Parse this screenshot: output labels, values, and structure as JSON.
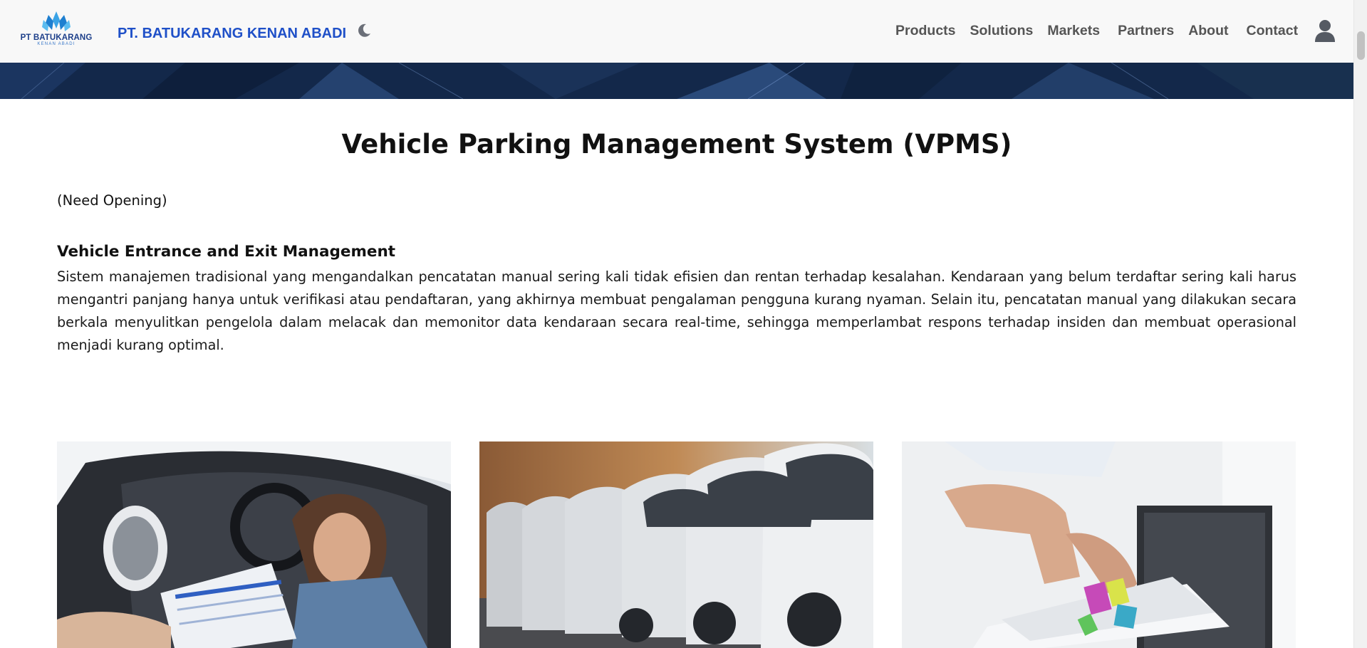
{
  "brand": {
    "logo_text": "PT BATUKARANG",
    "logo_subtext": "KENAN ABADI",
    "name": "PT. BATUKARANG KENAN ABADI"
  },
  "nav": {
    "items": [
      {
        "label": "Products"
      },
      {
        "label": "Solutions"
      },
      {
        "label": "Markets"
      },
      {
        "label": "Partners"
      },
      {
        "label": "About"
      },
      {
        "label": "Contact"
      }
    ]
  },
  "icons": {
    "theme_toggle": "moon-icon",
    "account": "user-icon"
  },
  "main": {
    "title": "Vehicle Parking Management System (VPMS)",
    "opening": "(Need Opening)",
    "section": {
      "heading": "Vehicle Entrance and Exit Management",
      "body": "Sistem manajemen tradisional yang mengandalkan pencatatan manual sering kali tidak efisien dan rentan terhadap kesalahan. Kendaraan yang belum terdaftar sering kali harus mengantri panjang hanya untuk verifikasi atau pendaftaran, yang akhirnya membuat pengalaman pengguna kurang nyaman. Selain itu, pencatatan manual yang dilakukan secara berkala menyulitkan pengelola dalam melacak dan memonitor data kendaraan secara real-time, sehingga memperlambat respons terhadap insiden dan membuat operasional menjadi kurang optimal."
    }
  },
  "gallery": {
    "images": [
      {
        "subject": "woman-in-car-clipboard-photo"
      },
      {
        "subject": "parked-cars-row-photo"
      },
      {
        "subject": "hands-sorting-papers-photo"
      }
    ]
  },
  "colors": {
    "brand_blue": "#1f50c8",
    "nav_text": "#555555",
    "navbar_bg": "#f8f8f8",
    "hero_navy": "#13284a"
  }
}
